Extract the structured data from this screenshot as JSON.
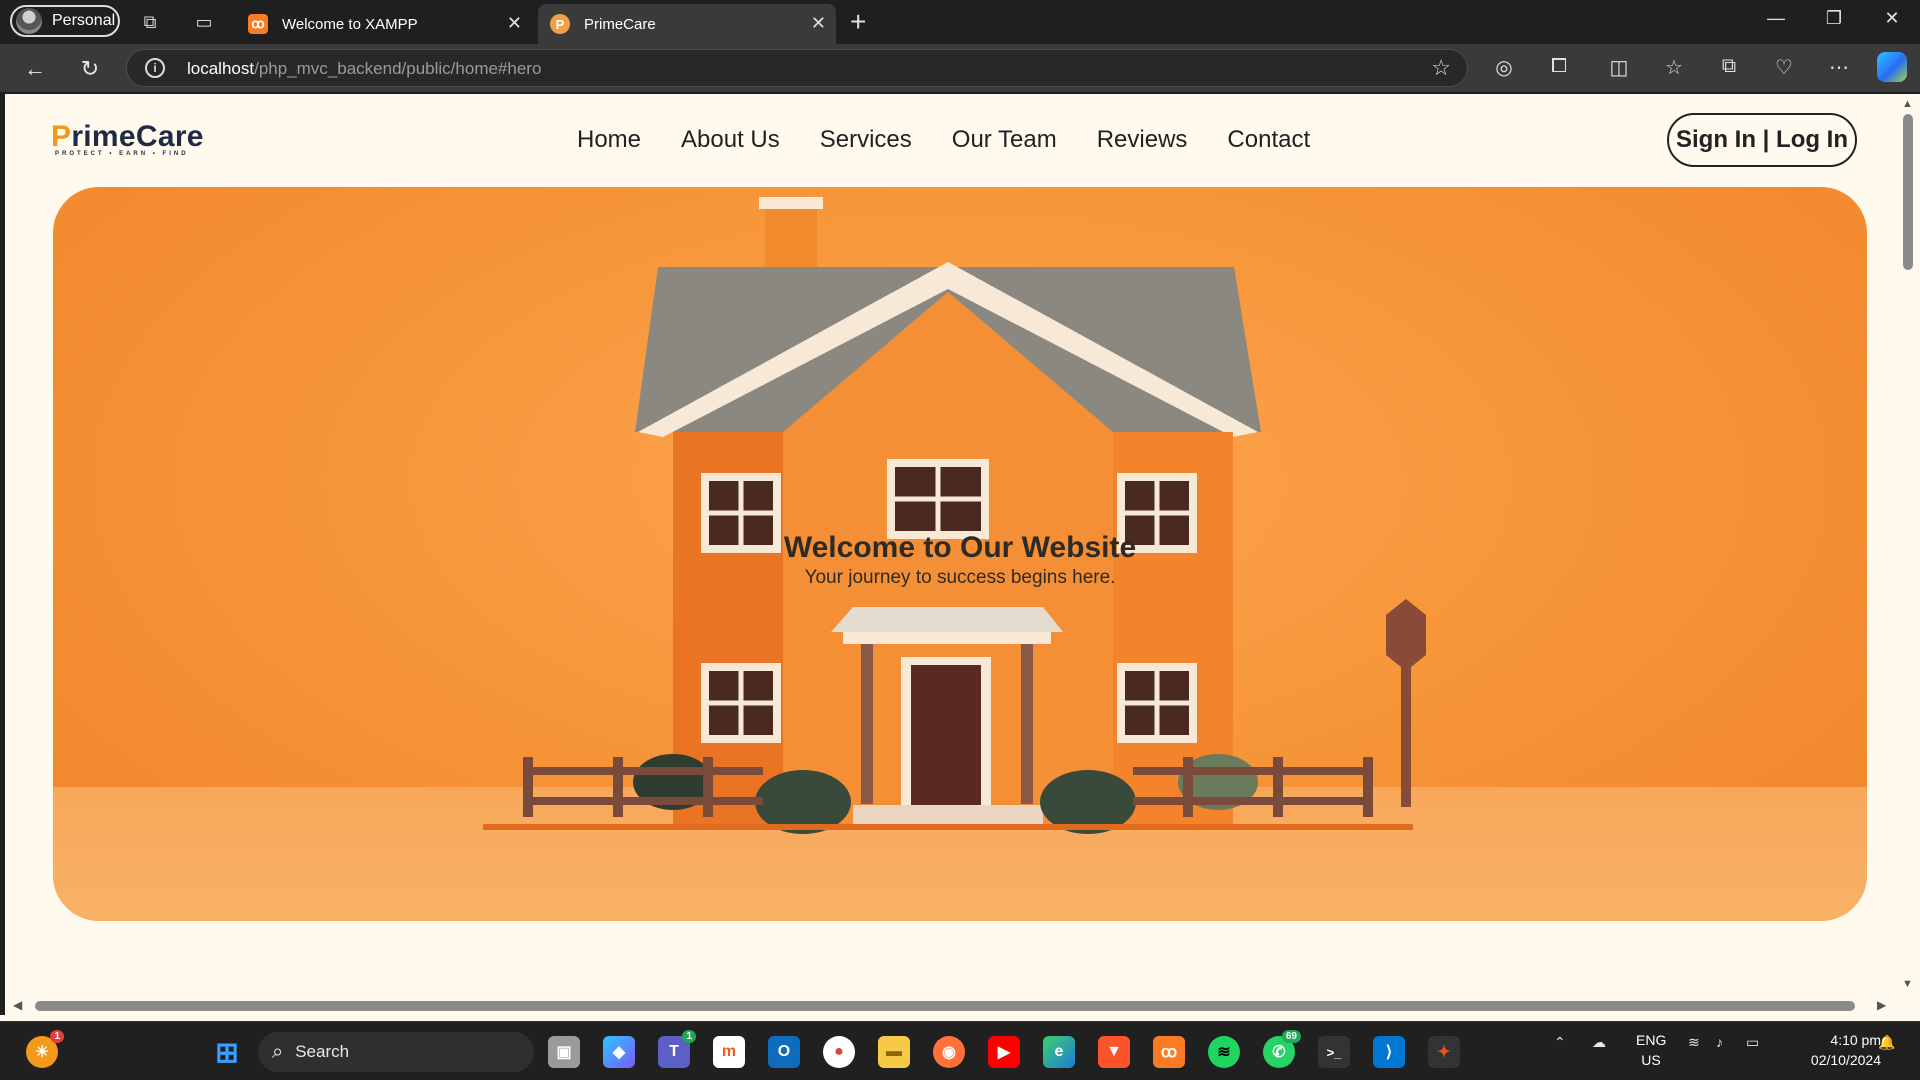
{
  "browser": {
    "profile_label": "Personal",
    "tabs": [
      {
        "title": "Welcome to XAMPP",
        "favicon": "xampp-icon"
      },
      {
        "title": "PrimeCare",
        "favicon": "primecare-icon",
        "favicon_letter": "P"
      }
    ],
    "url_host": "localhost",
    "url_path": "/php_mvc_backend/public/home#hero"
  },
  "site": {
    "logo_text": "rimeCare",
    "logo_first_letter": "P",
    "logo_tagline": "PROTECT • EARN • FIND",
    "nav": [
      "Home",
      "About Us",
      "Services",
      "Our Team",
      "Reviews",
      "Contact"
    ],
    "signin_label": "Sign In | Log In"
  },
  "hero": {
    "title": "Welcome to Our Website",
    "subtitle": "Your journey to success begins here."
  },
  "taskbar": {
    "search_label": "Search",
    "lang_top": "ENG",
    "lang_bottom": "US",
    "time": "4:10 pm",
    "date": "02/10/2024",
    "badges": {
      "weather": "1",
      "teams": "1",
      "whatsapp": "69"
    }
  },
  "colors": {
    "page_bg": "#fff9ee",
    "hero_orange": "#f7963a",
    "brand_dark": "#1f2a44",
    "brand_orange": "#f39a1a"
  }
}
